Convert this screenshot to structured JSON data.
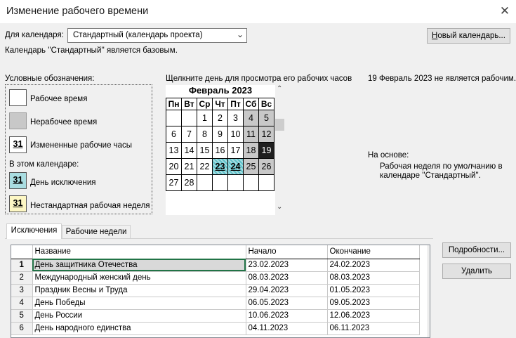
{
  "window": {
    "title": "Изменение рабочего времени",
    "close_glyph": "✕"
  },
  "calendar_select": {
    "label": "Для календаря:",
    "value": "Стандартный (календарь проекта)"
  },
  "base_note": "Календарь ''Стандартный'' является базовым.",
  "new_calendar_button": {
    "prefix": "Н",
    "rest": "овый календарь..."
  },
  "legend": {
    "title": "Условные обозначения:",
    "working": "Рабочее время",
    "nonworking": "Нерабочее время",
    "changed": "Измененные рабочие часы",
    "in_calendar": "В этом календаре:",
    "exception": "День исключения",
    "nonstandard": "Нестандартная рабочая неделя",
    "sample_day": "31"
  },
  "hint": "Щелкните день для просмотра его рабочих часов",
  "status": "19 Февраль 2023 не является рабочим.",
  "based_on": {
    "label": "На основе:",
    "text": "Рабочая неделя по умолчанию в календаре ''Стандартный''."
  },
  "month": {
    "title": "Февраль 2023",
    "weekdays": [
      "Пн",
      "Вт",
      "Ср",
      "Чт",
      "Пт",
      "Сб",
      "Вс"
    ],
    "weeks": [
      [
        "",
        "",
        "1",
        "2",
        "3",
        "4",
        "5"
      ],
      [
        "6",
        "7",
        "8",
        "9",
        "10",
        "11",
        "12"
      ],
      [
        "13",
        "14",
        "15",
        "16",
        "17",
        "18",
        "19"
      ],
      [
        "20",
        "21",
        "22",
        "23",
        "24",
        "25",
        "26"
      ],
      [
        "27",
        "28",
        "",
        "",
        "",
        "",
        ""
      ]
    ],
    "selected_day": "19",
    "exception_days": [
      "23",
      "24"
    ]
  },
  "tabs": [
    "Исключения",
    "Рабочие недели"
  ],
  "buttons": {
    "details": "Подробности...",
    "delete": "Удалить"
  },
  "table": {
    "columns": [
      "Название",
      "Начало",
      "Окончание"
    ],
    "rows": [
      {
        "n": "1",
        "name": "День защитника Отечества",
        "start": "23.02.2023",
        "end": "24.02.2023"
      },
      {
        "n": "2",
        "name": "Международный женский день",
        "start": "08.03.2023",
        "end": "08.03.2023"
      },
      {
        "n": "3",
        "name": "Праздник Весны и Труда",
        "start": "29.04.2023",
        "end": "01.05.2023"
      },
      {
        "n": "4",
        "name": "День Победы",
        "start": "06.05.2023",
        "end": "09.05.2023"
      },
      {
        "n": "5",
        "name": "День России",
        "start": "10.06.2023",
        "end": "12.06.2023"
      },
      {
        "n": "6",
        "name": "День народного единства",
        "start": "04.11.2023",
        "end": "06.11.2023"
      }
    ]
  },
  "colors": {
    "nonworking": "#c8c8c8",
    "selected": "#1f1f1f",
    "exception": "#5cc0c8",
    "changed": "#ffffff",
    "nonstandard": "#fdf7c4"
  }
}
